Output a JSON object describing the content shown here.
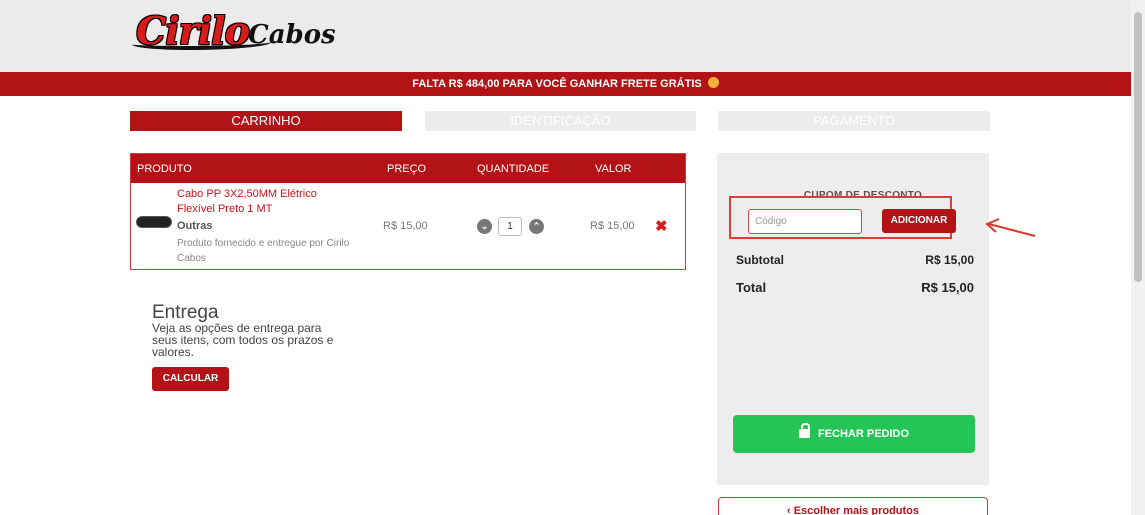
{
  "header": {
    "logo_main": "Cirilo",
    "logo_sub": "Cabos",
    "promo_prefix": "FALTA",
    "promo_amount": "R$ 484,00",
    "promo_suffix": "PARA VOCÊ GANHAR FRETE GRÁTIS"
  },
  "steps": [
    {
      "label": "CARRINHO",
      "active": true
    },
    {
      "label": "IDENTIFICAÇÃO",
      "active": false
    },
    {
      "label": "PAGAMENTO",
      "active": false
    }
  ],
  "cart": {
    "columns": [
      "PRODUTO",
      "PREÇO",
      "QUANTIDADE",
      "VALOR"
    ],
    "items": [
      {
        "name": "Cabo PP 3X2,50MM Elétrico Flexível Preto 1 MT",
        "category": "Outras",
        "note": "Produto fornecido e entregue por Cirilo Cabos",
        "price": "R$ 15,00",
        "quantity": "1",
        "value": "R$ 15,00"
      }
    ]
  },
  "entrega": {
    "title": "Entrega",
    "text": "Veja as opções de entrega para seus itens, com todos os prazos e valores.",
    "button": "CALCULAR"
  },
  "summary": {
    "coupon_label": "CUPOM DE DESCONTO",
    "coupon_placeholder": "Código",
    "coupon_button": "ADICIONAR",
    "subtotal_label": "Subtotal",
    "subtotal_value": "R$ 15,00",
    "total_label": "Total",
    "total_value": "R$ 15,00",
    "checkout_button": "FECHAR PEDIDO",
    "more_button": "Escolher mais produtos"
  },
  "colors": {
    "brand_red": "#b31217",
    "checkout_green": "#25c456",
    "highlight_red": "#e53935"
  },
  "icons": [
    "lock-icon",
    "chevron-down-icon",
    "chevron-up-icon",
    "remove-icon",
    "chevron-left-icon",
    "emoji-icon"
  ]
}
